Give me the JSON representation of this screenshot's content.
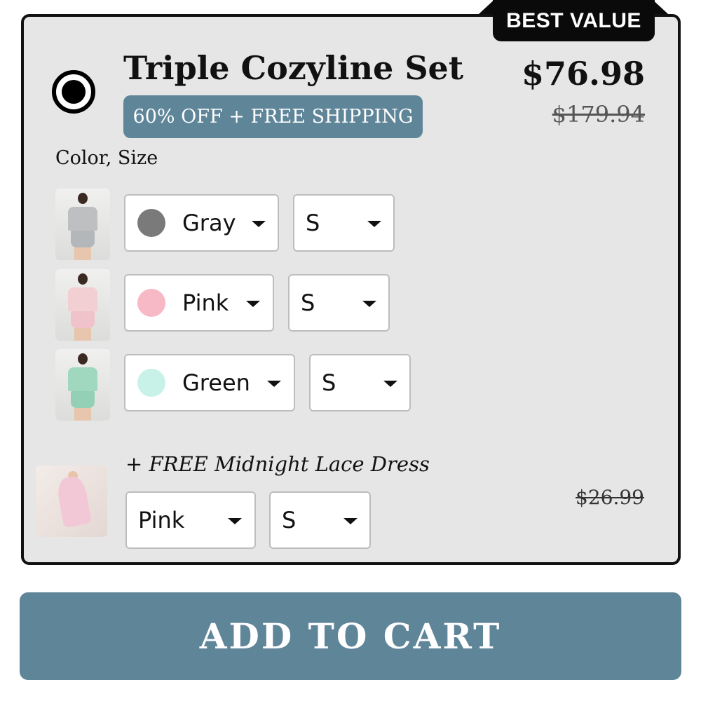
{
  "offer": {
    "badge": "BEST VALUE",
    "title": "Triple Cozyline Set",
    "promo": "60% OFF + FREE SHIPPING",
    "price": "$76.98",
    "original_price": "$179.94",
    "option_label": "Color, Size",
    "selected": true
  },
  "items": [
    {
      "color": "Gray",
      "color_hex": "#7a7a7a",
      "size": "S",
      "image": "gray-set-photo"
    },
    {
      "color": "Pink",
      "color_hex": "#f8b9c6",
      "size": "S",
      "image": "pink-set-photo"
    },
    {
      "color": "Green",
      "color_hex": "#c8f1e8",
      "size": "S",
      "image": "green-set-photo"
    }
  ],
  "free_gift": {
    "label": "+ FREE Midnight Lace Dress",
    "color": "Pink",
    "size": "S",
    "original_price": "$26.99",
    "image": "lace-dress-photo"
  },
  "cta": {
    "label": "ADD TO CART"
  },
  "colors": {
    "accent": "#5f8599",
    "card_bg": "#e6e6e6",
    "badge_bg": "#0a0a0a"
  }
}
